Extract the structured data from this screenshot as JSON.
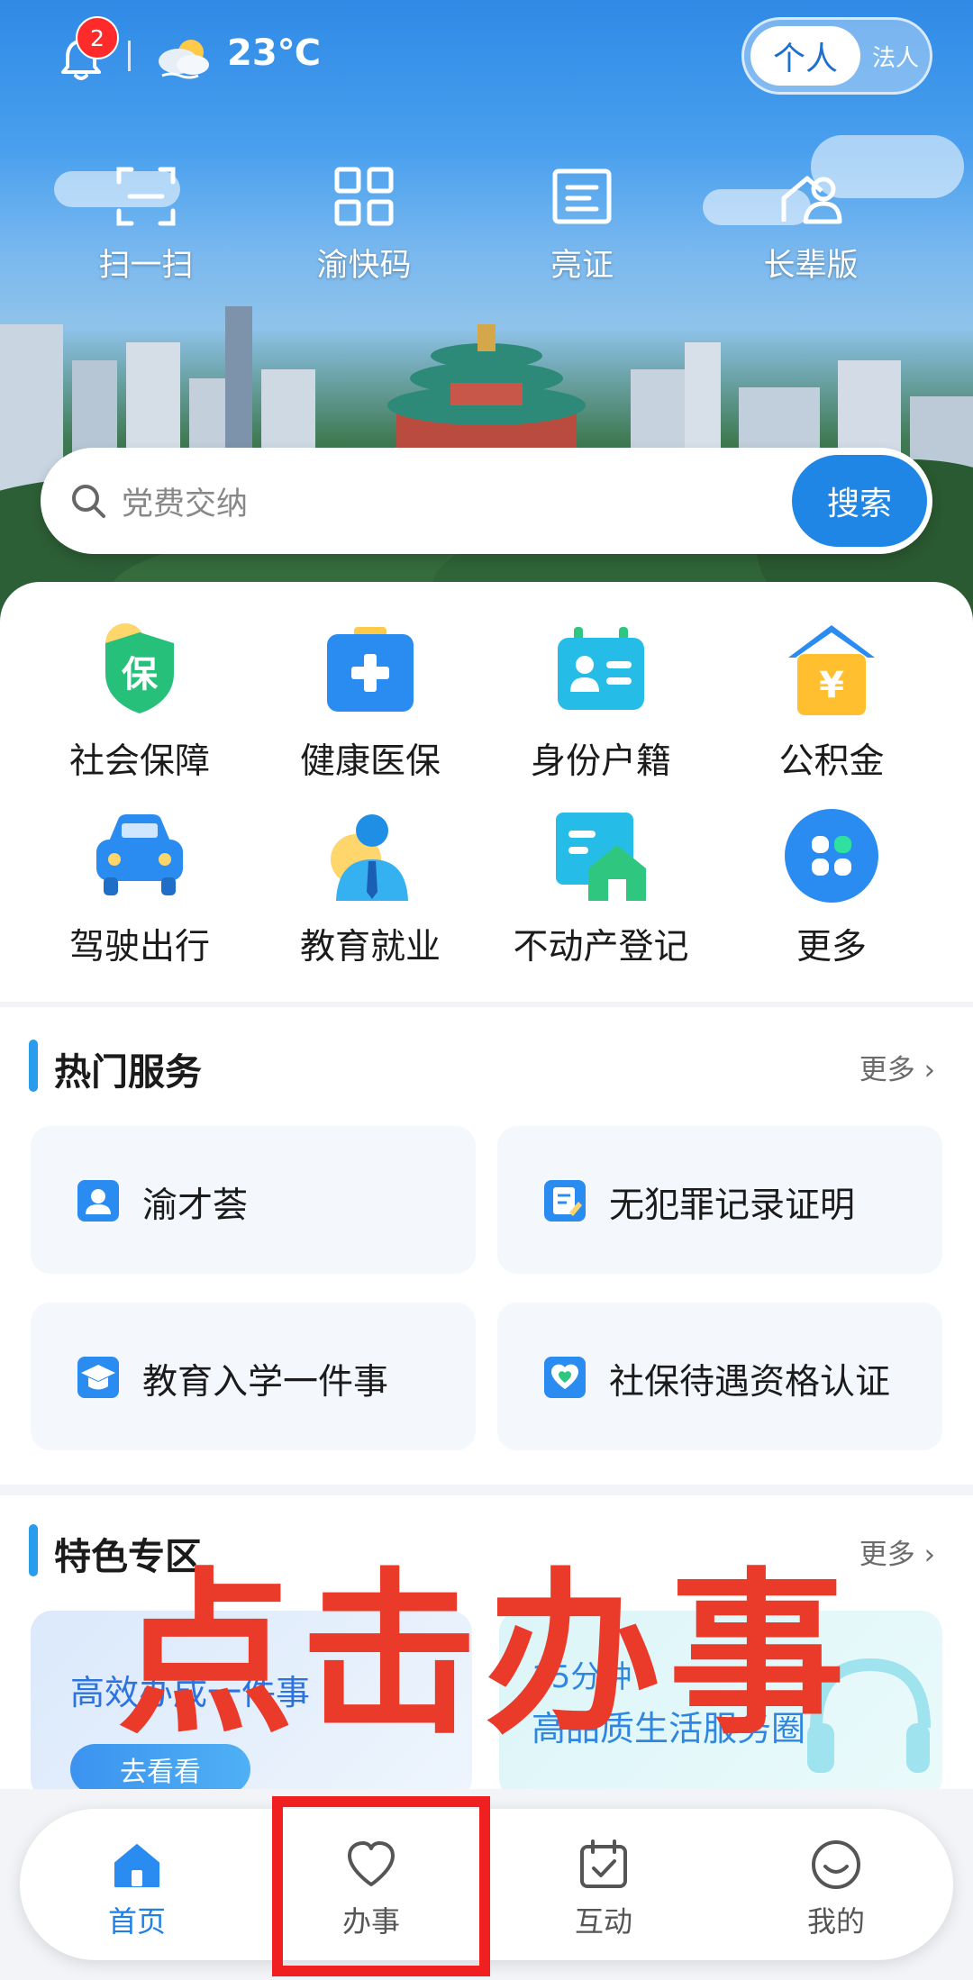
{
  "status": {
    "notification_count": "2",
    "temperature": "23℃"
  },
  "identity": {
    "personal": "个人",
    "legal": "法人"
  },
  "quick_actions": [
    {
      "label": "扫一扫",
      "icon": "scan-icon"
    },
    {
      "label": "渝快码",
      "icon": "qr-code-icon"
    },
    {
      "label": "亮证",
      "icon": "id-card-icon"
    },
    {
      "label": "长辈版",
      "icon": "elder-mode-icon"
    }
  ],
  "search": {
    "placeholder": "党费交纳",
    "button": "搜索"
  },
  "services_grid": [
    {
      "label": "社会保障",
      "icon": "social-security-icon"
    },
    {
      "label": "健康医保",
      "icon": "health-insurance-icon"
    },
    {
      "label": "身份户籍",
      "icon": "household-registration-icon"
    },
    {
      "label": "公积金",
      "icon": "housing-fund-icon"
    },
    {
      "label": "驾驶出行",
      "icon": "car-icon"
    },
    {
      "label": "教育就业",
      "icon": "education-employment-icon"
    },
    {
      "label": "不动产登记",
      "icon": "real-estate-icon"
    },
    {
      "label": "更多",
      "icon": "more-apps-icon"
    }
  ],
  "hot_services": {
    "title": "热门服务",
    "more": "更多",
    "items": [
      {
        "label": "渝才荟",
        "icon": "talent-icon"
      },
      {
        "label": "无犯罪记录证明",
        "icon": "certificate-icon"
      },
      {
        "label": "教育入学一件事",
        "icon": "graduation-cap-icon"
      },
      {
        "label": "社保待遇资格认证",
        "icon": "heart-shield-icon"
      }
    ]
  },
  "featured": {
    "title": "特色专区",
    "more": "更多",
    "card1": {
      "title": "高效办成一件事",
      "button": "去看看"
    },
    "card2": {
      "top": "15分钟",
      "title": "高品质生活服务圈"
    }
  },
  "annotation": {
    "text": "点击办事",
    "color": "#ea3a2a"
  },
  "tabbar": [
    {
      "label": "首页",
      "icon": "home-icon",
      "active": true
    },
    {
      "label": "办事",
      "icon": "heart-icon",
      "active": false
    },
    {
      "label": "互动",
      "icon": "calendar-check-icon",
      "active": false
    },
    {
      "label": "我的",
      "icon": "smiley-icon",
      "active": false
    }
  ],
  "colors": {
    "accent": "#1f86e6",
    "badge": "#ff2b2b",
    "highlight": "#f02020"
  }
}
